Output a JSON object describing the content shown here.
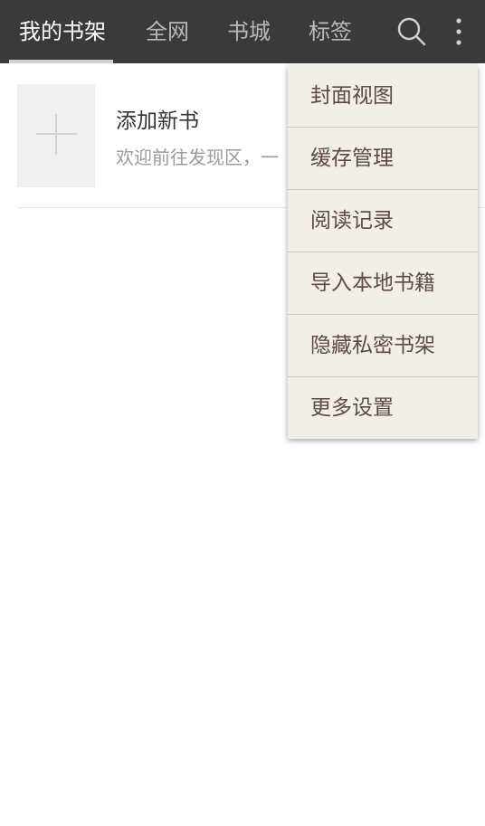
{
  "tabs": [
    {
      "label": "我的书架",
      "active": true
    },
    {
      "label": "全网",
      "active": false
    },
    {
      "label": "书城",
      "active": false
    },
    {
      "label": "标签",
      "active": false
    }
  ],
  "toolbar": {
    "search_icon": "search-icon",
    "more_icon": "more-vertical-icon"
  },
  "bookshelf": {
    "add_book_title": "添加新书",
    "add_book_desc": "欢迎前往发现区，一",
    "cover_icon": "plus-icon"
  },
  "menu": {
    "items": [
      {
        "label": "封面视图"
      },
      {
        "label": "缓存管理"
      },
      {
        "label": "阅读记录"
      },
      {
        "label": "导入本地书籍"
      },
      {
        "label": "隐藏私密书架"
      },
      {
        "label": "更多设置"
      }
    ]
  },
  "colors": {
    "topbar": "#3a3a3a",
    "menu_bg": "#f2efeb",
    "menu_text": "#5e4a40"
  }
}
